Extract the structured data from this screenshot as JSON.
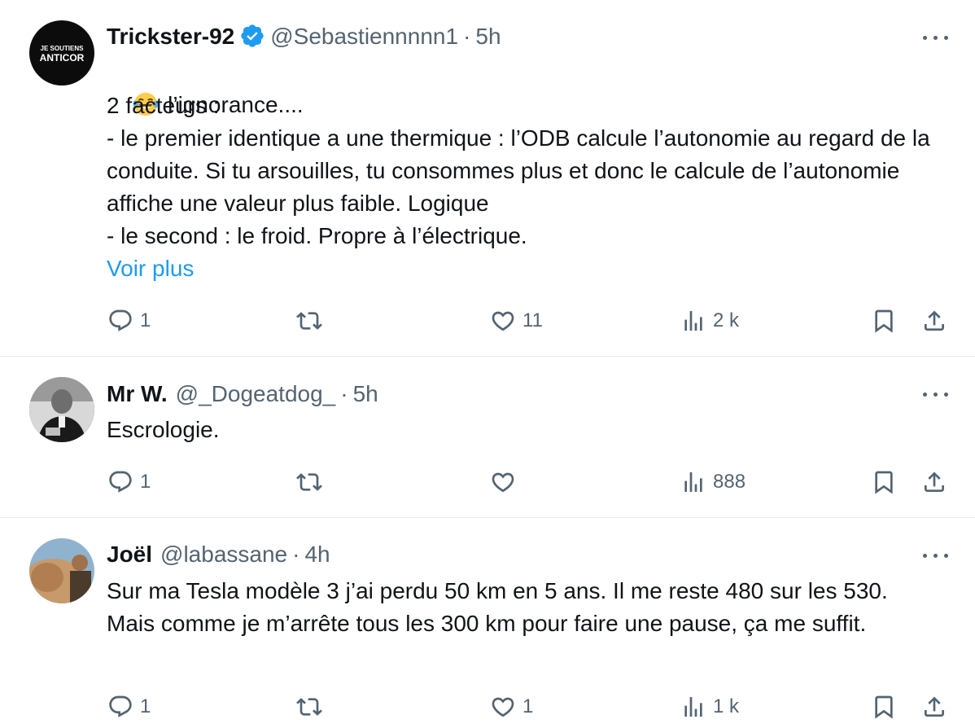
{
  "tweets": [
    {
      "name": "Trickster-92",
      "handle": "@Sebastiennnnn1",
      "sep": "·",
      "time": "5h",
      "verified": true,
      "avatar_text": [
        "JE SOUTIENS",
        "ANTICOR"
      ],
      "emoji": "face-with-tears-of-joy",
      "first_line": "l’ignorance....",
      "text": "2 facteurs :\n- le premier identique a une thermique : l’ODB calcule l’autonomie au regard de la conduite. Si tu arsouilles, tu consommes plus et donc le calcule de l’autonomie affiche une valeur plus faible. Logique\n- le second : le froid. Propre à l’électrique.",
      "more_link": "Voir plus",
      "replies": "1",
      "retweets": "",
      "likes": "11",
      "views": "2 k"
    },
    {
      "name": "Mr W.",
      "handle": "@_Dogeatdog_",
      "sep": "·",
      "time": "5h",
      "text": "Escrologie.",
      "replies": "1",
      "retweets": "",
      "likes": "",
      "views": "888"
    },
    {
      "name": "Joël",
      "handle": "@labassane",
      "sep": "·",
      "time": "4h",
      "text": "Sur ma Tesla modèle 3 j’ai perdu 50 km en 5 ans. Il me reste 480 sur les 530. Mais comme je m’arrête tous les 300 km pour faire une pause, ça me suffit.",
      "replies": "1",
      "retweets": "",
      "likes": "1",
      "views": "1 k"
    }
  ],
  "colors": {
    "text": "#0f1419",
    "muted": "#536471",
    "link": "#1d9bf0",
    "verified": "#1d9bf0",
    "divider": "#e6ecf0"
  }
}
